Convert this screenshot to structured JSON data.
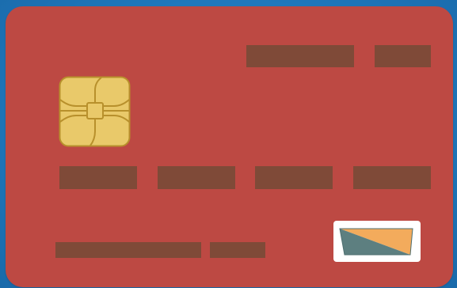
{
  "card": {
    "colors": {
      "background": "#1f77bb",
      "card": "#bd4943",
      "placeholder_bars": "#7f4a38",
      "chip_fill": "#e9c96a",
      "chip_lines": "#b8902c",
      "logo_background": "#ffffff",
      "logo_slate": "#5d7f80",
      "logo_orange": "#f3ab5c"
    },
    "icons": {
      "chip": "emv-chip-icon",
      "logo": "card-network-logo-icon"
    }
  }
}
